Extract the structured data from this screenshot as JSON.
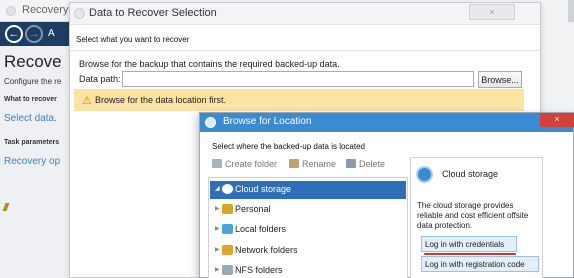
{
  "background_window": {
    "title": "Recovery",
    "nav_partial_text": "A",
    "heading": "Recove",
    "configure_text": "Configure the re",
    "what_label": "What to recover",
    "select_data_link": "Select data.",
    "task_params_label": "Task parameters",
    "recovery_options_link": "Recovery op"
  },
  "recover_dialog": {
    "title": "Data to Recover Selection",
    "close_glyph": "×",
    "instruction": "Select what you want to recover",
    "browse_hint": "Browse for the backup that contains the required backed-up data.",
    "path_label": "Data path:",
    "path_value": "",
    "browse_button": "Browse...",
    "warning_icon": "⚠",
    "warning_text": "Browse for the data location first."
  },
  "browse_dialog": {
    "title": "Browse for Location",
    "close_glyph": "×",
    "prompt": "Select where the backed-up data is located",
    "toolbar": {
      "create_folder": "Create folder",
      "rename": "Rename",
      "delete": "Delete"
    },
    "tree": [
      {
        "label": "Cloud storage",
        "icon": "cloud-icon",
        "selected": true
      },
      {
        "label": "Personal",
        "icon": "personal-folder-icon"
      },
      {
        "label": "Local folders",
        "icon": "local-folders-icon"
      },
      {
        "label": "Network folders",
        "icon": "network-folders-icon"
      },
      {
        "label": "NFS folders",
        "icon": "nfs-folders-icon"
      }
    ],
    "info": {
      "title": "Cloud storage",
      "description": "The cloud storage provides reliable and cost efficient offsite data protection.",
      "login_credentials": "Log in with credentials",
      "login_registration": "Log in with registration code"
    }
  },
  "colors": {
    "nav_bar": "#1e3d62",
    "link": "#3f7fc4",
    "warning_bg": "#fbe3a3",
    "dialog_title_bg": "#3b8ad2",
    "selected_tree": "#2f6fb8",
    "close_red": "#d3413c",
    "underline_red": "#d5312b"
  },
  "arrow_glyph": "▶",
  "expand_glyph": "◢",
  "back_glyph": "←",
  "forward_glyph": "→"
}
